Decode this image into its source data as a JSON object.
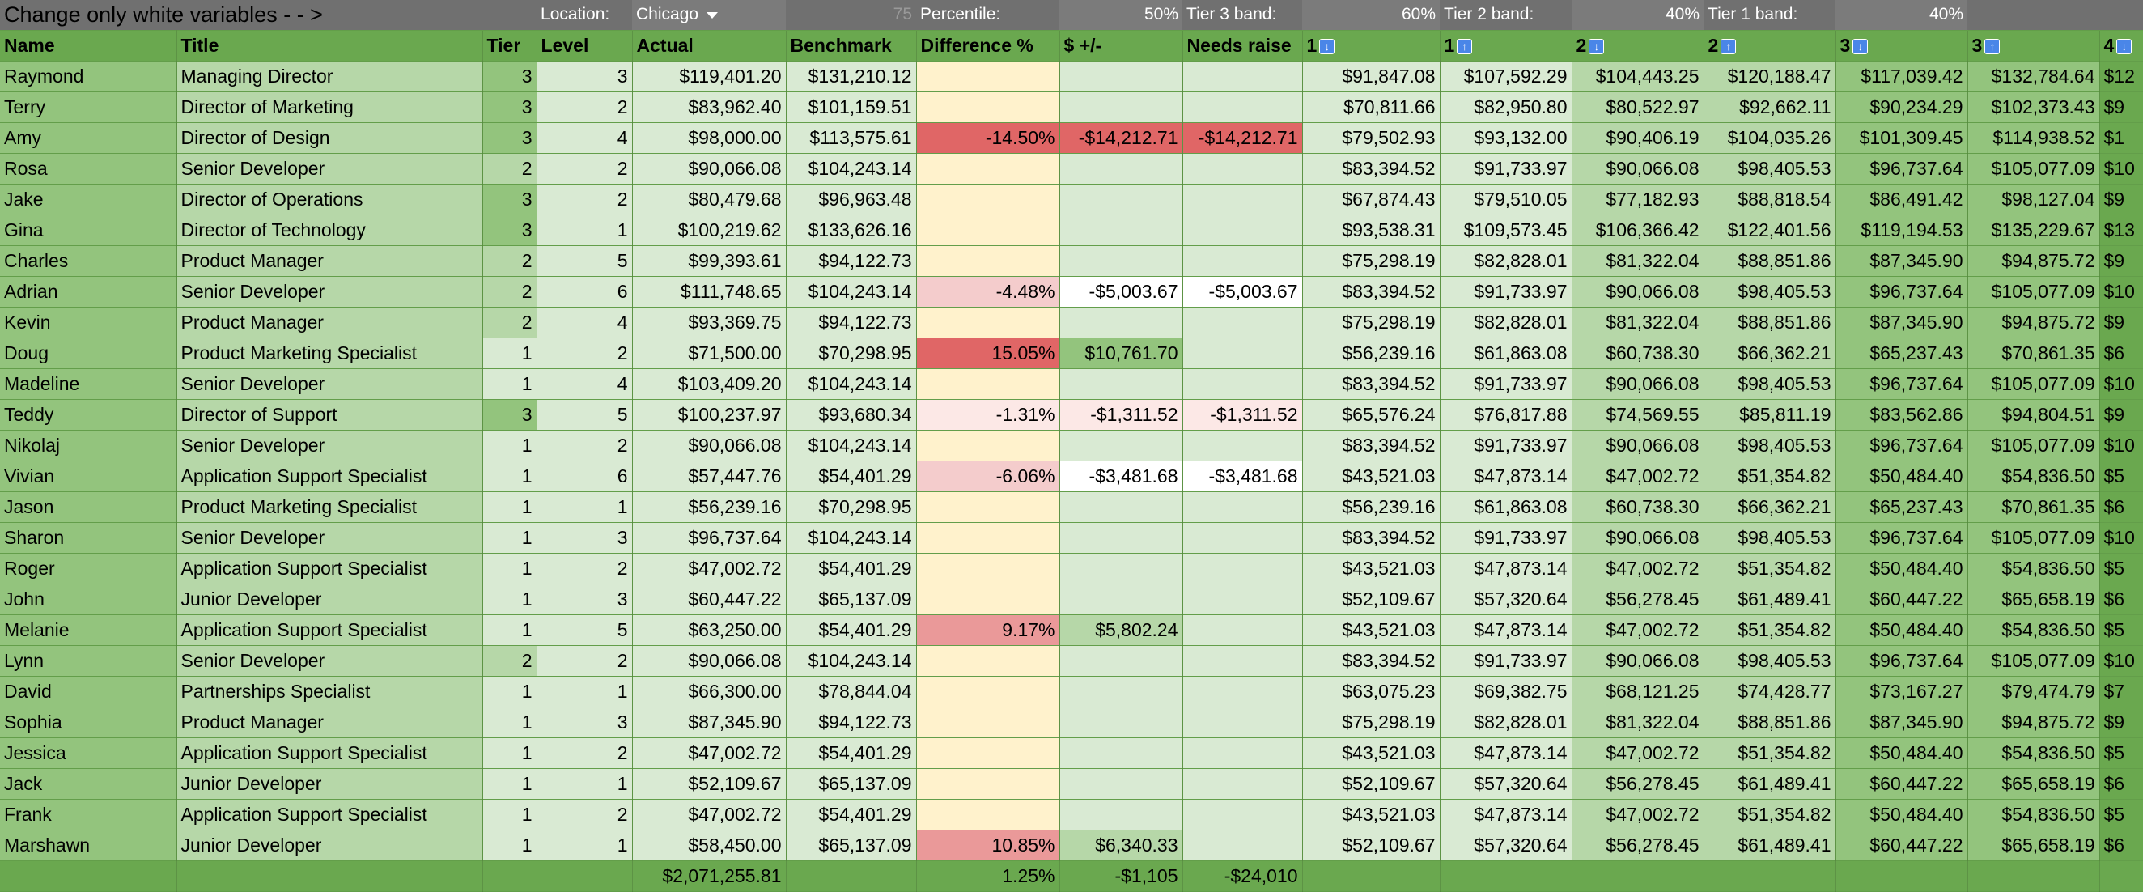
{
  "top": {
    "instruction": "Change only white variables - - >",
    "location_label": "Location:",
    "location_value": "Chicago",
    "location_count": "75",
    "percentile_label": "Percentile:",
    "percentile_value": "50%",
    "tier3_label": "Tier 3 band:",
    "tier3_value": "60%",
    "tier2_label": "Tier 2 band:",
    "tier2_value": "40%",
    "tier1_label": "Tier 1 band:",
    "tier1_value": "40%"
  },
  "headers": {
    "name": "Name",
    "title": "Title",
    "tier": "Tier",
    "level": "Level",
    "actual": "Actual",
    "benchmark": "Benchmark",
    "diff": "Difference %",
    "plus": "$ +/-",
    "raise": "Needs raise",
    "b1": "1",
    "b1b": "1",
    "b2": "2",
    "b2b": "2",
    "b3": "3",
    "b3b": "3",
    "b4": "4"
  },
  "icons": {
    "down": "arrow-down-icon",
    "up": "arrow-up-icon"
  },
  "rows": [
    {
      "name": "Raymond",
      "title": "Managing Director",
      "tier": "3",
      "level": "3",
      "actual": "$119,401.20",
      "benchmark": "$131,210.12",
      "diff": "",
      "plus": "",
      "raise": "",
      "b1": "$91,847.08",
      "b1b": "$107,592.29",
      "b2": "$104,443.25",
      "b2b": "$120,188.47",
      "b3": "$117,039.42",
      "b3b": "$132,784.64",
      "b4": "$12"
    },
    {
      "name": "Terry",
      "title": "Director of Marketing",
      "tier": "3",
      "level": "2",
      "actual": "$83,962.40",
      "benchmark": "$101,159.51",
      "diff": "",
      "plus": "",
      "raise": "",
      "b1": "$70,811.66",
      "b1b": "$82,950.80",
      "b2": "$80,522.97",
      "b2b": "$92,662.11",
      "b3": "$90,234.29",
      "b3b": "$102,373.43",
      "b4": "$9"
    },
    {
      "name": "Amy",
      "title": "Director of Design",
      "tier": "3",
      "level": "4",
      "actual": "$98,000.00",
      "benchmark": "$113,575.61",
      "diff": "-14.50%",
      "plus": "-$14,212.71",
      "raise": "-$14,212.71",
      "b1": "$79,502.93",
      "b1b": "$93,132.00",
      "b2": "$90,406.19",
      "b2b": "$104,035.26",
      "b3": "$101,309.45",
      "b3b": "$114,938.52",
      "b4": "$1"
    },
    {
      "name": "Rosa",
      "title": "Senior Developer",
      "tier": "2",
      "level": "2",
      "actual": "$90,066.08",
      "benchmark": "$104,243.14",
      "diff": "",
      "plus": "",
      "raise": "",
      "b1": "$83,394.52",
      "b1b": "$91,733.97",
      "b2": "$90,066.08",
      "b2b": "$98,405.53",
      "b3": "$96,737.64",
      "b3b": "$105,077.09",
      "b4": "$10"
    },
    {
      "name": "Jake",
      "title": "Director of Operations",
      "tier": "3",
      "level": "2",
      "actual": "$80,479.68",
      "benchmark": "$96,963.48",
      "diff": "",
      "plus": "",
      "raise": "",
      "b1": "$67,874.43",
      "b1b": "$79,510.05",
      "b2": "$77,182.93",
      "b2b": "$88,818.54",
      "b3": "$86,491.42",
      "b3b": "$98,127.04",
      "b4": "$9"
    },
    {
      "name": "Gina",
      "title": "Director of Technology",
      "tier": "3",
      "level": "1",
      "actual": "$100,219.62",
      "benchmark": "$133,626.16",
      "diff": "",
      "plus": "",
      "raise": "",
      "b1": "$93,538.31",
      "b1b": "$109,573.45",
      "b2": "$106,366.42",
      "b2b": "$122,401.56",
      "b3": "$119,194.53",
      "b3b": "$135,229.67",
      "b4": "$13"
    },
    {
      "name": "Charles",
      "title": "Product Manager",
      "tier": "2",
      "level": "5",
      "actual": "$99,393.61",
      "benchmark": "$94,122.73",
      "diff": "",
      "plus": "",
      "raise": "",
      "b1": "$75,298.19",
      "b1b": "$82,828.01",
      "b2": "$81,322.04",
      "b2b": "$88,851.86",
      "b3": "$87,345.90",
      "b3b": "$94,875.72",
      "b4": "$9"
    },
    {
      "name": "Adrian",
      "title": "Senior Developer",
      "tier": "2",
      "level": "6",
      "actual": "$111,748.65",
      "benchmark": "$104,243.14",
      "diff": "-4.48%",
      "plus": "-$5,003.67",
      "raise": "-$5,003.67",
      "b1": "$83,394.52",
      "b1b": "$91,733.97",
      "b2": "$90,066.08",
      "b2b": "$98,405.53",
      "b3": "$96,737.64",
      "b3b": "$105,077.09",
      "b4": "$10"
    },
    {
      "name": "Kevin",
      "title": "Product Manager",
      "tier": "2",
      "level": "4",
      "actual": "$93,369.75",
      "benchmark": "$94,122.73",
      "diff": "",
      "plus": "",
      "raise": "",
      "b1": "$75,298.19",
      "b1b": "$82,828.01",
      "b2": "$81,322.04",
      "b2b": "$88,851.86",
      "b3": "$87,345.90",
      "b3b": "$94,875.72",
      "b4": "$9"
    },
    {
      "name": "Doug",
      "title": "Product Marketing Specialist",
      "tier": "1",
      "level": "2",
      "actual": "$71,500.00",
      "benchmark": "$70,298.95",
      "diff": "15.05%",
      "plus": "$10,761.70",
      "raise": "",
      "b1": "$56,239.16",
      "b1b": "$61,863.08",
      "b2": "$60,738.30",
      "b2b": "$66,362.21",
      "b3": "$65,237.43",
      "b3b": "$70,861.35",
      "b4": "$6"
    },
    {
      "name": "Madeline",
      "title": "Senior Developer",
      "tier": "1",
      "level": "4",
      "actual": "$103,409.20",
      "benchmark": "$104,243.14",
      "diff": "",
      "plus": "",
      "raise": "",
      "b1": "$83,394.52",
      "b1b": "$91,733.97",
      "b2": "$90,066.08",
      "b2b": "$98,405.53",
      "b3": "$96,737.64",
      "b3b": "$105,077.09",
      "b4": "$10"
    },
    {
      "name": "Teddy",
      "title": "Director of Support",
      "tier": "3",
      "level": "5",
      "actual": "$100,237.97",
      "benchmark": "$93,680.34",
      "diff": "-1.31%",
      "plus": "-$1,311.52",
      "raise": "-$1,311.52",
      "b1": "$65,576.24",
      "b1b": "$76,817.88",
      "b2": "$74,569.55",
      "b2b": "$85,811.19",
      "b3": "$83,562.86",
      "b3b": "$94,804.51",
      "b4": "$9"
    },
    {
      "name": "Nikolaj",
      "title": "Senior Developer",
      "tier": "1",
      "level": "2",
      "actual": "$90,066.08",
      "benchmark": "$104,243.14",
      "diff": "",
      "plus": "",
      "raise": "",
      "b1": "$83,394.52",
      "b1b": "$91,733.97",
      "b2": "$90,066.08",
      "b2b": "$98,405.53",
      "b3": "$96,737.64",
      "b3b": "$105,077.09",
      "b4": "$10"
    },
    {
      "name": "Vivian",
      "title": "Application Support Specialist",
      "tier": "1",
      "level": "6",
      "actual": "$57,447.76",
      "benchmark": "$54,401.29",
      "diff": "-6.06%",
      "plus": "-$3,481.68",
      "raise": "-$3,481.68",
      "b1": "$43,521.03",
      "b1b": "$47,873.14",
      "b2": "$47,002.72",
      "b2b": "$51,354.82",
      "b3": "$50,484.40",
      "b3b": "$54,836.50",
      "b4": "$5"
    },
    {
      "name": "Jason",
      "title": "Product Marketing Specialist",
      "tier": "1",
      "level": "1",
      "actual": "$56,239.16",
      "benchmark": "$70,298.95",
      "diff": "",
      "plus": "",
      "raise": "",
      "b1": "$56,239.16",
      "b1b": "$61,863.08",
      "b2": "$60,738.30",
      "b2b": "$66,362.21",
      "b3": "$65,237.43",
      "b3b": "$70,861.35",
      "b4": "$6"
    },
    {
      "name": "Sharon",
      "title": "Senior Developer",
      "tier": "1",
      "level": "3",
      "actual": "$96,737.64",
      "benchmark": "$104,243.14",
      "diff": "",
      "plus": "",
      "raise": "",
      "b1": "$83,394.52",
      "b1b": "$91,733.97",
      "b2": "$90,066.08",
      "b2b": "$98,405.53",
      "b3": "$96,737.64",
      "b3b": "$105,077.09",
      "b4": "$10"
    },
    {
      "name": "Roger",
      "title": "Application Support Specialist",
      "tier": "1",
      "level": "2",
      "actual": "$47,002.72",
      "benchmark": "$54,401.29",
      "diff": "",
      "plus": "",
      "raise": "",
      "b1": "$43,521.03",
      "b1b": "$47,873.14",
      "b2": "$47,002.72",
      "b2b": "$51,354.82",
      "b3": "$50,484.40",
      "b3b": "$54,836.50",
      "b4": "$5"
    },
    {
      "name": "John",
      "title": "Junior Developer",
      "tier": "1",
      "level": "3",
      "actual": "$60,447.22",
      "benchmark": "$65,137.09",
      "diff": "",
      "plus": "",
      "raise": "",
      "b1": "$52,109.67",
      "b1b": "$57,320.64",
      "b2": "$56,278.45",
      "b2b": "$61,489.41",
      "b3": "$60,447.22",
      "b3b": "$65,658.19",
      "b4": "$6"
    },
    {
      "name": "Melanie",
      "title": "Application Support Specialist",
      "tier": "1",
      "level": "5",
      "actual": "$63,250.00",
      "benchmark": "$54,401.29",
      "diff": "9.17%",
      "plus": "$5,802.24",
      "raise": "",
      "b1": "$43,521.03",
      "b1b": "$47,873.14",
      "b2": "$47,002.72",
      "b2b": "$51,354.82",
      "b3": "$50,484.40",
      "b3b": "$54,836.50",
      "b4": "$5"
    },
    {
      "name": "Lynn",
      "title": "Senior Developer",
      "tier": "2",
      "level": "2",
      "actual": "$90,066.08",
      "benchmark": "$104,243.14",
      "diff": "",
      "plus": "",
      "raise": "",
      "b1": "$83,394.52",
      "b1b": "$91,733.97",
      "b2": "$90,066.08",
      "b2b": "$98,405.53",
      "b3": "$96,737.64",
      "b3b": "$105,077.09",
      "b4": "$10"
    },
    {
      "name": "David",
      "title": "Partnerships Specialist",
      "tier": "1",
      "level": "1",
      "actual": "$66,300.00",
      "benchmark": "$78,844.04",
      "diff": "",
      "plus": "",
      "raise": "",
      "b1": "$63,075.23",
      "b1b": "$69,382.75",
      "b2": "$68,121.25",
      "b2b": "$74,428.77",
      "b3": "$73,167.27",
      "b3b": "$79,474.79",
      "b4": "$7"
    },
    {
      "name": "Sophia",
      "title": "Product Manager",
      "tier": "1",
      "level": "3",
      "actual": "$87,345.90",
      "benchmark": "$94,122.73",
      "diff": "",
      "plus": "",
      "raise": "",
      "b1": "$75,298.19",
      "b1b": "$82,828.01",
      "b2": "$81,322.04",
      "b2b": "$88,851.86",
      "b3": "$87,345.90",
      "b3b": "$94,875.72",
      "b4": "$9"
    },
    {
      "name": "Jessica",
      "title": "Application Support Specialist",
      "tier": "1",
      "level": "2",
      "actual": "$47,002.72",
      "benchmark": "$54,401.29",
      "diff": "",
      "plus": "",
      "raise": "",
      "b1": "$43,521.03",
      "b1b": "$47,873.14",
      "b2": "$47,002.72",
      "b2b": "$51,354.82",
      "b3": "$50,484.40",
      "b3b": "$54,836.50",
      "b4": "$5"
    },
    {
      "name": "Jack",
      "title": "Junior Developer",
      "tier": "1",
      "level": "1",
      "actual": "$52,109.67",
      "benchmark": "$65,137.09",
      "diff": "",
      "plus": "",
      "raise": "",
      "b1": "$52,109.67",
      "b1b": "$57,320.64",
      "b2": "$56,278.45",
      "b2b": "$61,489.41",
      "b3": "$60,447.22",
      "b3b": "$65,658.19",
      "b4": "$6"
    },
    {
      "name": "Frank",
      "title": "Application Support Specialist",
      "tier": "1",
      "level": "2",
      "actual": "$47,002.72",
      "benchmark": "$54,401.29",
      "diff": "",
      "plus": "",
      "raise": "",
      "b1": "$43,521.03",
      "b1b": "$47,873.14",
      "b2": "$47,002.72",
      "b2b": "$51,354.82",
      "b3": "$50,484.40",
      "b3b": "$54,836.50",
      "b4": "$5"
    },
    {
      "name": "Marshawn",
      "title": "Junior Developer",
      "tier": "1",
      "level": "1",
      "actual": "$58,450.00",
      "benchmark": "$65,137.09",
      "diff": "10.85%",
      "plus": "$6,340.33",
      "raise": "",
      "b1": "$52,109.67",
      "b1b": "$57,320.64",
      "b2": "$56,278.45",
      "b2b": "$61,489.41",
      "b3": "$60,447.22",
      "b3b": "$65,658.19",
      "b4": "$6"
    }
  ],
  "footer": {
    "actual_total": "$2,071,255.81",
    "diff_total": "1.25%",
    "plus_total": "-$1,105",
    "raise_total": "-$24,010"
  },
  "colors": {
    "header_green": "#6aa84f",
    "light_green": "#d9ead3",
    "mid_green": "#b6d7a8",
    "dark_green": "#93c47d",
    "yellow": "#fff2cc",
    "red": "#e06666"
  }
}
